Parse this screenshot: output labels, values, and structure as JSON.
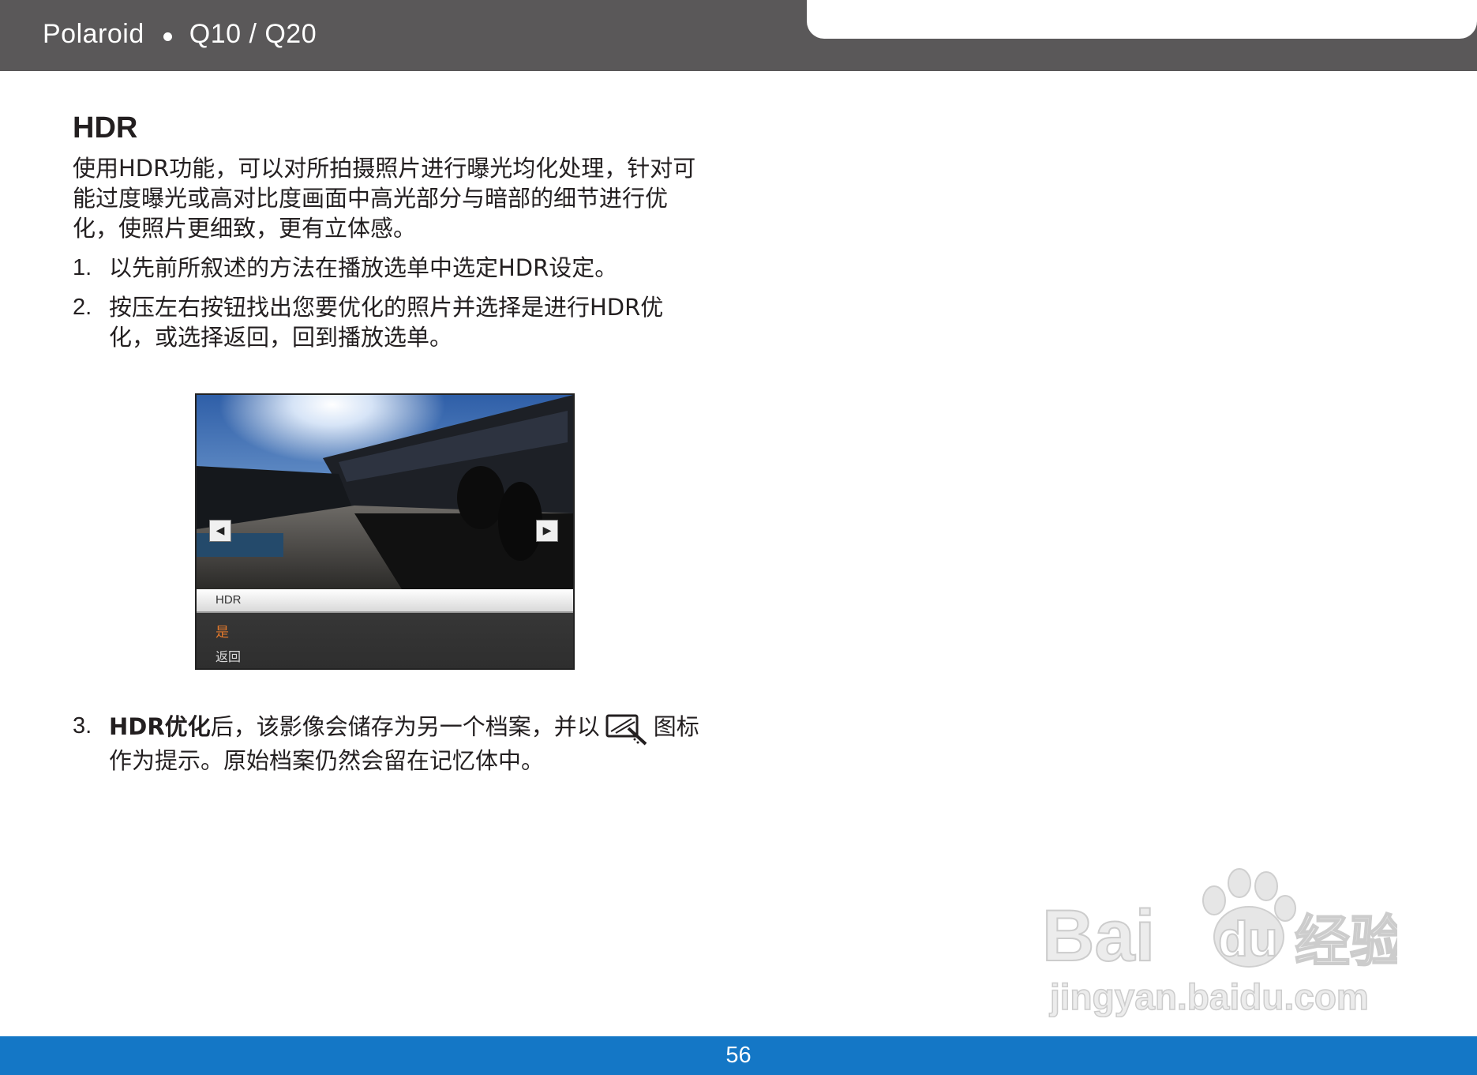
{
  "header": {
    "brand": "Polaroid",
    "model": "Q10 / Q20"
  },
  "section": {
    "title": "HDR",
    "intro": "使用HDR功能，可以对所拍摄照片进行曝光均化处理，针对可能过度曝光或高对比度画面中高光部分与暗部的细节进行优化，使照片更细致，更有立体感。",
    "steps": [
      {
        "num": "1.",
        "text": "以先前所叙述的方法在播放选单中选定HDR设定。"
      },
      {
        "num": "2.",
        "text": "按压左右按钮找出您要优化的照片并选择是进行HDR优化，或选择返回，回到播放选单。"
      }
    ],
    "step3": {
      "num": "3.",
      "bold": "HDR优化",
      "text_before_icon": "后，该影像会储存为另一个档案，并以",
      "text_after_icon": "图标作为提示。原始档案仍然会留在记忆体中。",
      "icon": "hdr-edited-icon"
    }
  },
  "camera_screen": {
    "menu_title": "HDR",
    "option_yes": "是",
    "option_back": "返回",
    "selected_color": "#e2792c",
    "left_arrow_icon": "triangle-left-icon",
    "right_arrow_icon": "triangle-right-icon"
  },
  "watermark": {
    "brand_a": "Bai",
    "brand_b": "du",
    "brand_c": "经验",
    "url": "jingyan.baidu.com"
  },
  "footer": {
    "page_number": "56",
    "color": "#1477c6"
  }
}
